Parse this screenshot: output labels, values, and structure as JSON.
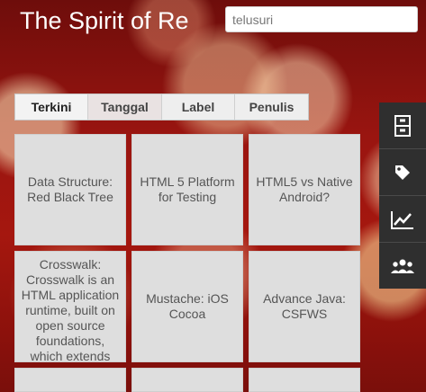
{
  "header": {
    "title": "The Spirit of Re"
  },
  "search": {
    "placeholder": "telusuri"
  },
  "tabs": [
    {
      "label": "Terkini"
    },
    {
      "label": "Tanggal"
    },
    {
      "label": "Label"
    },
    {
      "label": "Penulis"
    }
  ],
  "posts": [
    {
      "title": "Data Structure: Red Black Tree"
    },
    {
      "title": "HTML 5 Platform for Testing"
    },
    {
      "title": "HTML5 vs Native Android?"
    },
    {
      "title": "Crosswalk: Crosswalk is an HTML application runtime, built on open source foundations, which extends the"
    },
    {
      "title": "Mustache: iOS Cocoa"
    },
    {
      "title": "Advance Java: CSFWS"
    }
  ],
  "side_icons": [
    "archive-icon",
    "tag-icon",
    "trending-icon",
    "people-icon"
  ]
}
